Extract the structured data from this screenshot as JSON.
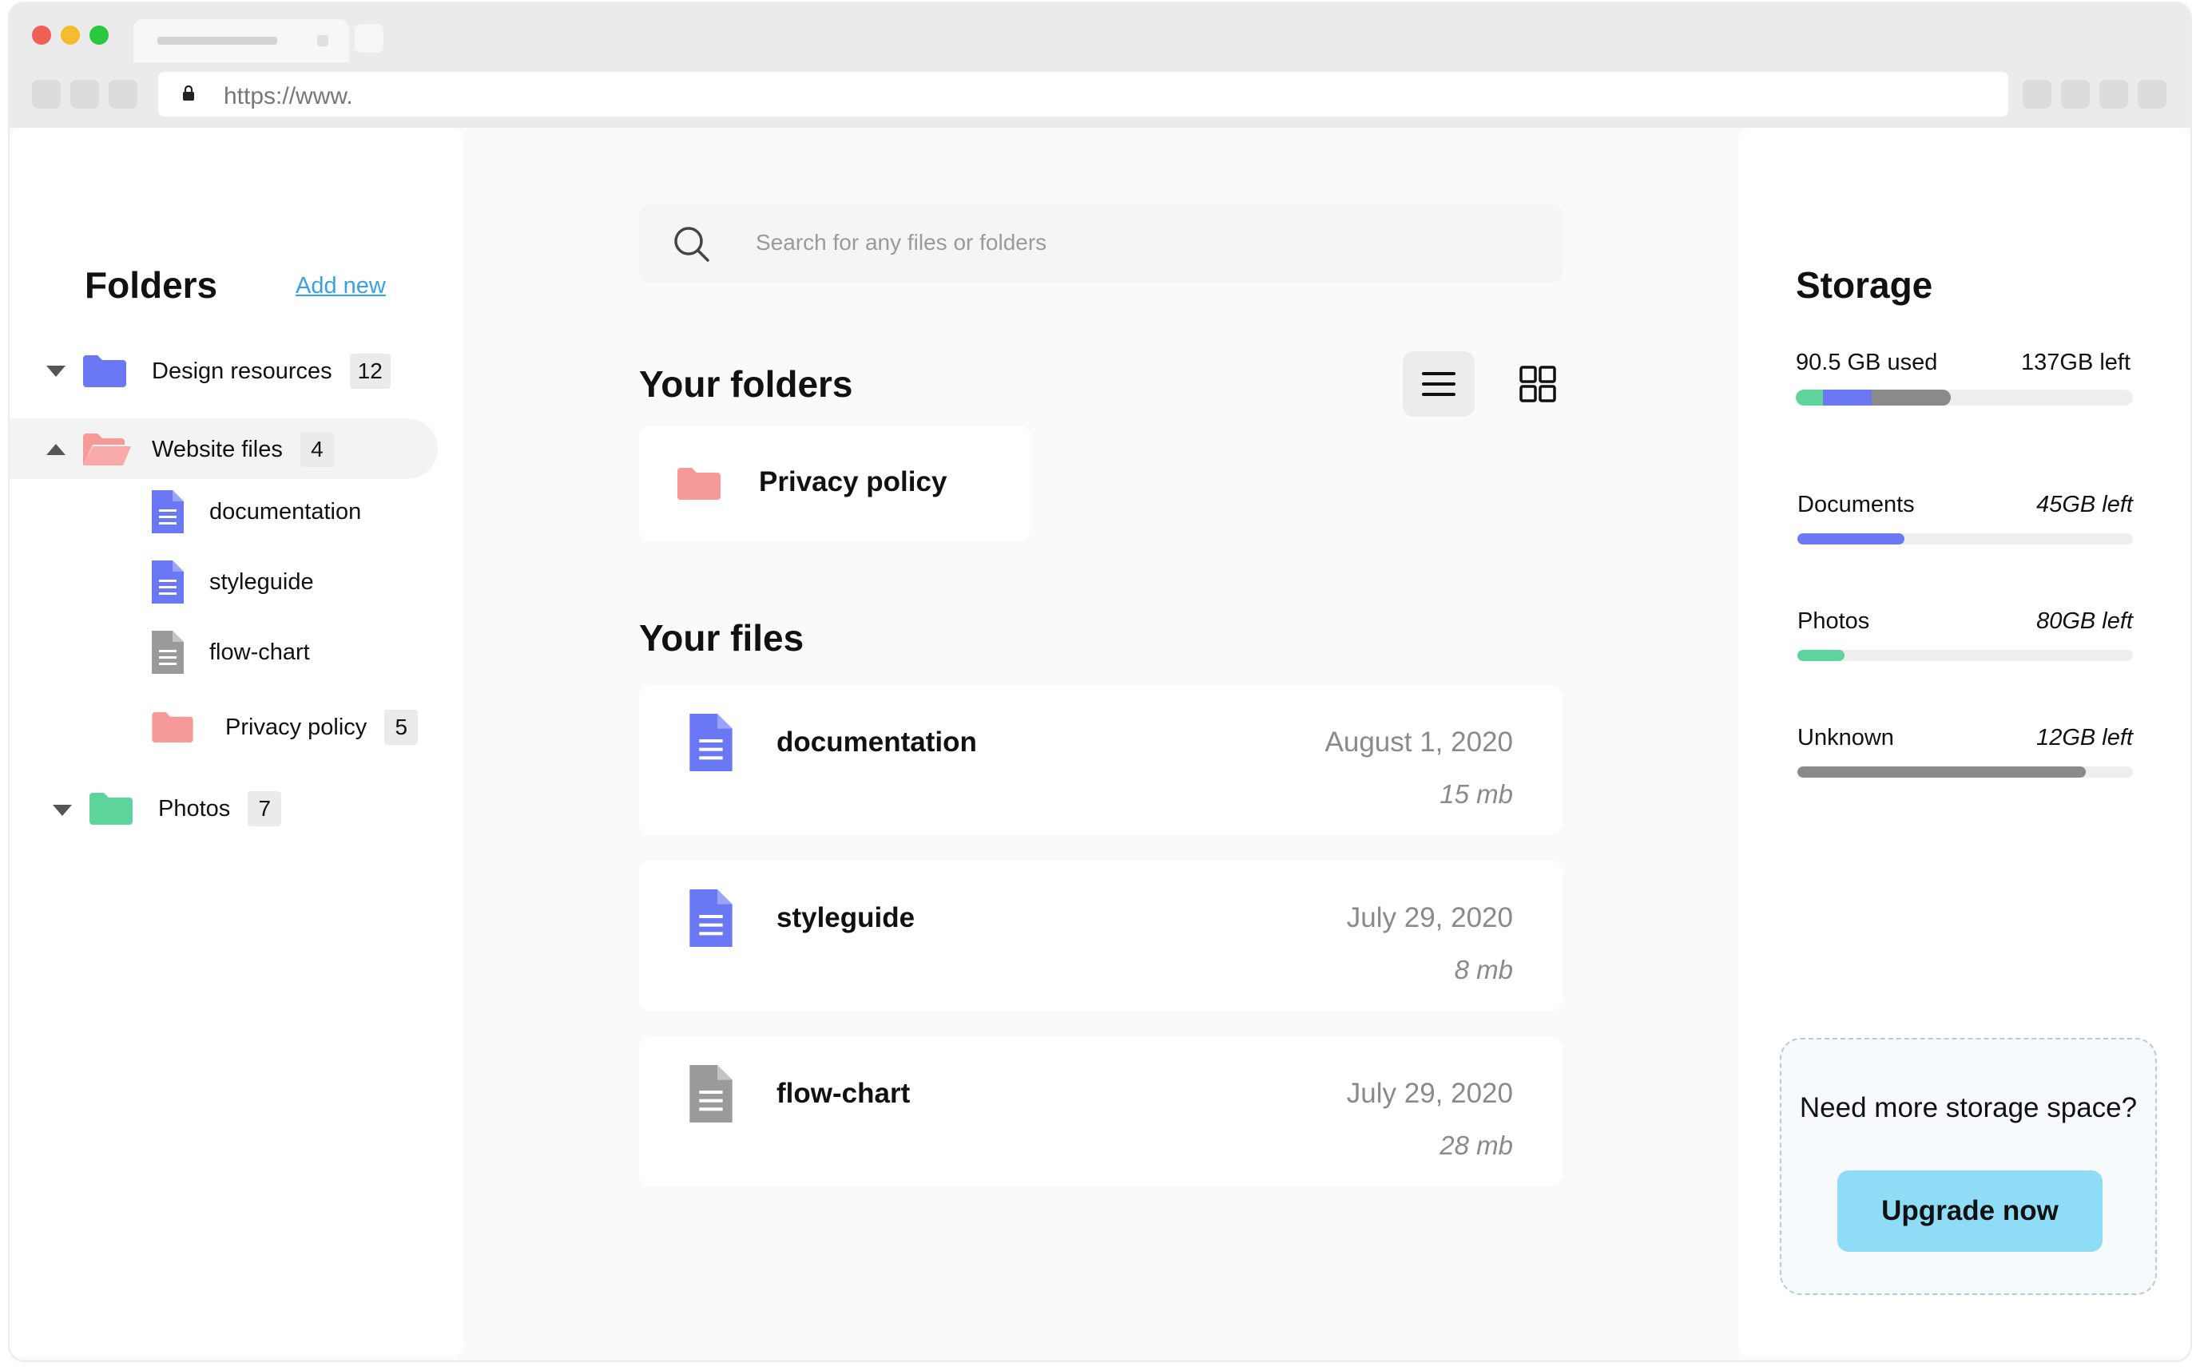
{
  "browser": {
    "url": "https://www.",
    "traffic_lights": [
      "#ee5f57",
      "#f5bd2e",
      "#2ac740"
    ]
  },
  "folders_panel": {
    "title": "Folders",
    "add_new_label": "Add new",
    "items": [
      {
        "label": "Design resources",
        "count": "12",
        "color": "#6a78f5",
        "expanded": false
      },
      {
        "label": "Website files",
        "count": "4",
        "color": "#f59a98",
        "expanded": true
      },
      {
        "label": "documentation",
        "icon": "document-icon",
        "color": "#6a78f5"
      },
      {
        "label": "styleguide",
        "icon": "document-icon",
        "color": "#6a78f5"
      },
      {
        "label": "flow-chart",
        "icon": "document-icon",
        "color": "#9a9a9a"
      },
      {
        "label": "Privacy policy",
        "count": "5",
        "color": "#f59a98"
      },
      {
        "label": "Photos",
        "count": "7",
        "color": "#5ed39c",
        "expanded": false
      }
    ]
  },
  "search": {
    "placeholder": "Search for any files or folders"
  },
  "main": {
    "folders_heading": "Your folders",
    "folders": [
      {
        "name": "Privacy policy",
        "color": "#f59a98"
      }
    ],
    "files_heading": "Your files",
    "files": [
      {
        "name": "documentation",
        "date": "August 1, 2020",
        "size": "15 mb",
        "color": "#6a78f5"
      },
      {
        "name": "styleguide",
        "date": "July 29, 2020",
        "size": "8 mb",
        "color": "#6a78f5"
      },
      {
        "name": "flow-chart",
        "date": "July 29, 2020",
        "size": "28 mb",
        "color": "#9a9a9a"
      }
    ]
  },
  "storage": {
    "title": "Storage",
    "used_label": "90.5 GB used",
    "left_label": "137GB left",
    "usage_breakdown": [
      {
        "color": "#5ed39c",
        "fraction": 0.08
      },
      {
        "color": "#6a78f5",
        "fraction": 0.145
      },
      {
        "color": "#8a8a8a",
        "fraction": 0.235
      }
    ],
    "categories": [
      {
        "name": "Documents",
        "left": "45GB left",
        "fraction": 0.32,
        "color": "#6a78f5"
      },
      {
        "name": "Photos",
        "left": "80GB left",
        "fraction": 0.14,
        "color": "#5ed39c"
      },
      {
        "name": "Unknown",
        "left": "12GB left",
        "fraction": 0.86,
        "color": "#8a8a8a"
      }
    ]
  },
  "promo": {
    "text": "Need more storage space?",
    "button_label": "Upgrade now"
  }
}
